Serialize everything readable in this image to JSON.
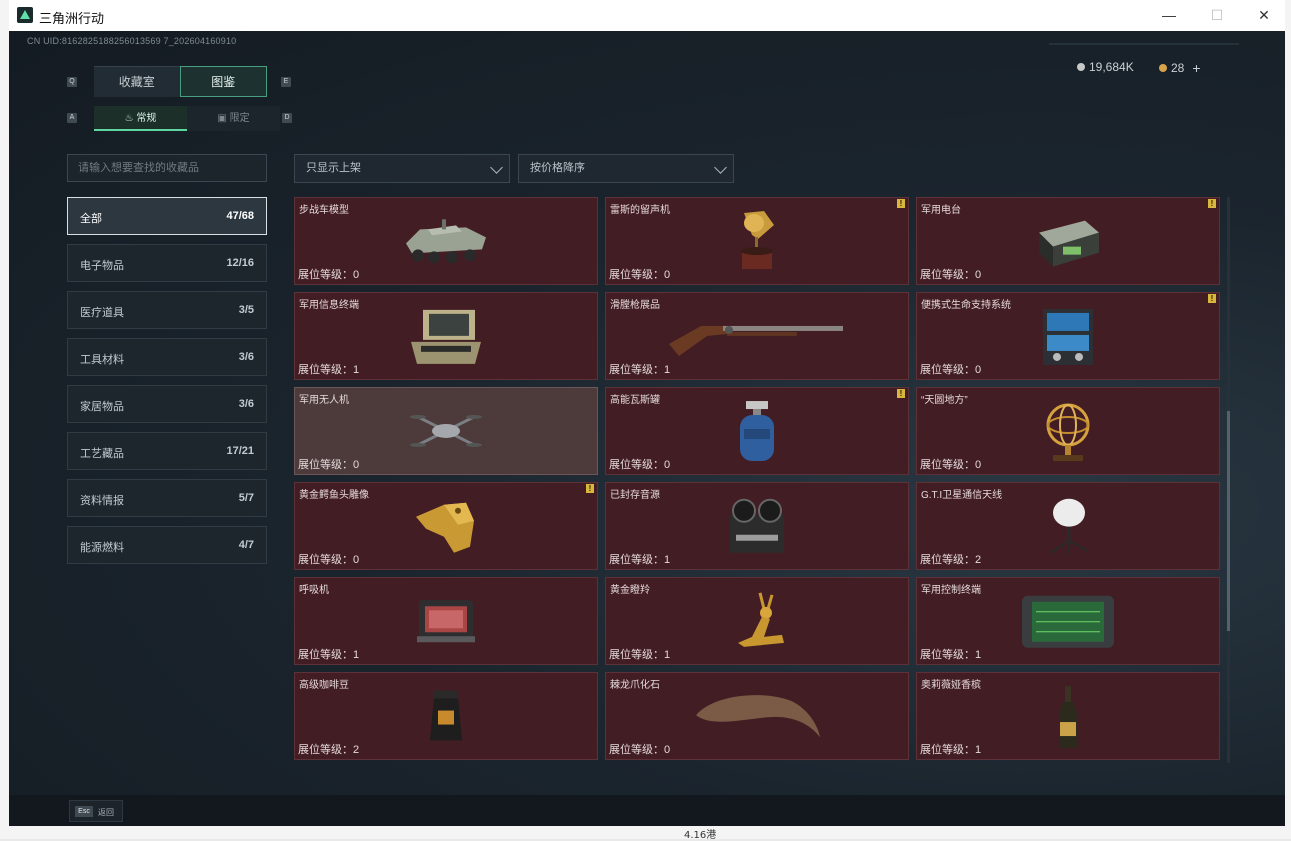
{
  "window": {
    "title": "三角洲行动",
    "minimize": "—",
    "maximize": "☐",
    "close": "✕"
  },
  "header": {
    "uid": "CN UID:8162825188256013569 7_202604160910",
    "silver": "19,684K",
    "gold": "28",
    "plus": "+"
  },
  "hotkeys": {
    "q": "Q",
    "e": "E",
    "a": "A",
    "d": "D"
  },
  "tabs": [
    {
      "label": "收藏室"
    },
    {
      "label": "图鉴"
    }
  ],
  "subtabs": [
    {
      "icon": "♨",
      "label": "常规"
    },
    {
      "icon": "▣",
      "label": "限定"
    }
  ],
  "search": {
    "placeholder": "请输入想要查找的收藏品"
  },
  "filters": {
    "shelf": "只显示上架",
    "sort": "按价格降序"
  },
  "categories": [
    {
      "label": "全部",
      "count": "47/68"
    },
    {
      "label": "电子物品",
      "count": "12/16"
    },
    {
      "label": "医疗道具",
      "count": "3/5"
    },
    {
      "label": "工具材料",
      "count": "3/6"
    },
    {
      "label": "家居物品",
      "count": "3/6"
    },
    {
      "label": "工艺藏品",
      "count": "17/21"
    },
    {
      "label": "资料情报",
      "count": "5/7"
    },
    {
      "label": "能源燃料",
      "count": "4/7"
    }
  ],
  "items": [
    {
      "name": "步战车模型",
      "level": "展位等级：0",
      "icon": "ifv-model-icon",
      "warn": ""
    },
    {
      "name": "雷斯的留声机",
      "level": "展位等级：0",
      "icon": "gramophone-icon",
      "warn": "!"
    },
    {
      "name": "军用电台",
      "level": "展位等级：0",
      "icon": "military-radio-icon",
      "warn": "!"
    },
    {
      "name": "军用信息终端",
      "level": "展位等级：1",
      "icon": "info-terminal-icon",
      "warn": ""
    },
    {
      "name": "滑膛枪展品",
      "level": "展位等级：1",
      "icon": "musket-icon",
      "warn": ""
    },
    {
      "name": "便携式生命支持系统",
      "level": "展位等级：0",
      "icon": "life-support-icon",
      "warn": "!"
    },
    {
      "name": "军用无人机",
      "level": "展位等级：0",
      "icon": "drone-icon",
      "warn": ""
    },
    {
      "name": "高能瓦斯罐",
      "level": "展位等级：0",
      "icon": "gas-tank-icon",
      "warn": "!"
    },
    {
      "name": "“天圆地方”",
      "level": "展位等级：0",
      "icon": "armillary-sphere-icon",
      "warn": ""
    },
    {
      "name": "黄金鳄鱼头雕像",
      "level": "展位等级：0",
      "icon": "gold-crocodile-icon",
      "warn": "!"
    },
    {
      "name": "已封存音源",
      "level": "展位等级：1",
      "icon": "tape-recorder-icon",
      "warn": ""
    },
    {
      "name": "G.T.I卫星通信天线",
      "level": "展位等级：2",
      "icon": "satellite-dish-icon",
      "warn": ""
    },
    {
      "name": "呼吸机",
      "level": "展位等级：1",
      "icon": "ventilator-icon",
      "warn": ""
    },
    {
      "name": "黄金瞪羚",
      "level": "展位等级：1",
      "icon": "gold-gazelle-icon",
      "warn": ""
    },
    {
      "name": "军用控制终端",
      "level": "展位等级：1",
      "icon": "control-terminal-icon",
      "warn": ""
    },
    {
      "name": "高级咖啡豆",
      "level": "展位等级：2",
      "icon": "coffee-beans-icon",
      "warn": ""
    },
    {
      "name": "棘龙爪化石",
      "level": "展位等级：0",
      "icon": "claw-fossil-icon",
      "warn": ""
    },
    {
      "name": "奥莉薇娅香槟",
      "level": "展位等级：1",
      "icon": "champagne-icon",
      "warn": ""
    }
  ],
  "footer": {
    "esc_key": "Esc",
    "esc_label": "返回"
  },
  "desktop": {
    "bottom_text": "4.16港"
  }
}
